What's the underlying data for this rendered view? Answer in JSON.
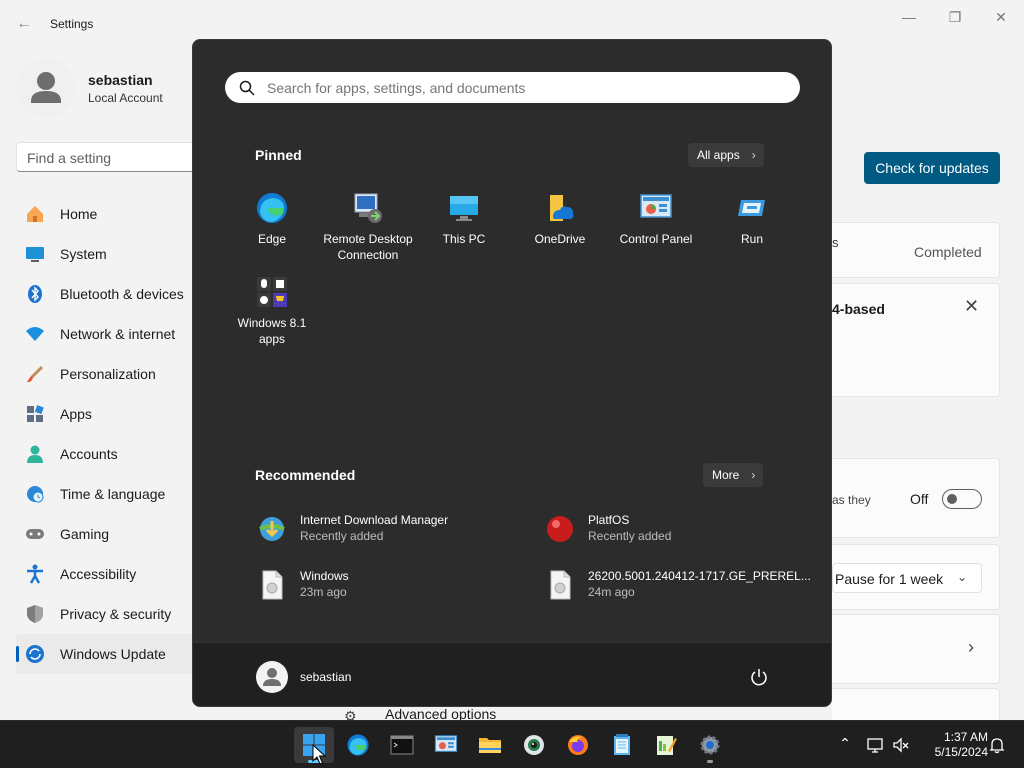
{
  "settings": {
    "app_title": "Settings",
    "user": {
      "name": "sebastian",
      "account_type": "Local Account"
    },
    "search_placeholder": "Find a setting",
    "nav": [
      {
        "label": "Home",
        "icon": "home-icon"
      },
      {
        "label": "System",
        "icon": "monitor-icon"
      },
      {
        "label": "Bluetooth & devices",
        "icon": "bluetooth-icon"
      },
      {
        "label": "Network & internet",
        "icon": "wifi-icon"
      },
      {
        "label": "Personalization",
        "icon": "brush-icon"
      },
      {
        "label": "Apps",
        "icon": "apps-icon"
      },
      {
        "label": "Accounts",
        "icon": "person-icon"
      },
      {
        "label": "Time & language",
        "icon": "clock-globe-icon"
      },
      {
        "label": "Gaming",
        "icon": "gamepad-icon"
      },
      {
        "label": "Accessibility",
        "icon": "accessibility-icon"
      },
      {
        "label": "Privacy & security",
        "icon": "shield-icon"
      },
      {
        "label": "Windows Update",
        "icon": "update-icon",
        "active": true
      }
    ],
    "check_updates_label": "Check for updates",
    "card_fragment_s": "s",
    "status_completed": "Completed",
    "card_fragment_based": "4-based",
    "card_fragment_asthey": "as they",
    "toggle_label": "Off",
    "pause_label": "Pause for 1 week",
    "advanced_options": "Advanced options"
  },
  "start_menu": {
    "search_placeholder": "Search for apps, settings, and documents",
    "pinned_title": "Pinned",
    "all_apps_label": "All apps",
    "pinned": [
      {
        "label": "Edge",
        "icon": "edge-icon"
      },
      {
        "label": "Remote Desktop Connection",
        "icon": "remote-desktop-icon"
      },
      {
        "label": "This PC",
        "icon": "this-pc-icon"
      },
      {
        "label": "OneDrive",
        "icon": "onedrive-icon"
      },
      {
        "label": "Control Panel",
        "icon": "control-panel-icon"
      },
      {
        "label": "Run",
        "icon": "run-icon"
      },
      {
        "label": "Windows 8.1 apps",
        "icon": "windows81-apps-icon"
      }
    ],
    "recommended_title": "Recommended",
    "more_label": "More",
    "recommended": [
      {
        "title": "Internet Download Manager",
        "subtitle": "Recently added",
        "icon": "idm-icon"
      },
      {
        "title": "PlatfOS",
        "subtitle": "Recently added",
        "icon": "red-ball-icon"
      },
      {
        "title": "Windows",
        "subtitle": "23m ago",
        "icon": "file-icon"
      },
      {
        "title": "26200.5001.240412-1717.GE_PREREL...",
        "subtitle": "24m ago",
        "icon": "file-icon"
      }
    ],
    "user_name": "sebastian"
  },
  "taskbar": {
    "apps": [
      {
        "name": "start-button",
        "icon": "windows-logo-icon",
        "active": true
      },
      {
        "name": "edge-taskbar",
        "icon": "edge-icon"
      },
      {
        "name": "terminal-taskbar",
        "icon": "terminal-icon"
      },
      {
        "name": "control-panel-taskbar",
        "icon": "control-panel-icon"
      },
      {
        "name": "file-explorer-taskbar",
        "icon": "folder-icon"
      },
      {
        "name": "browser-taskbar",
        "icon": "globe-icon"
      },
      {
        "name": "firefox-taskbar",
        "icon": "firefox-icon"
      },
      {
        "name": "notepad-taskbar",
        "icon": "notepad-icon"
      },
      {
        "name": "editor-taskbar",
        "icon": "editor-icon"
      },
      {
        "name": "settings-taskbar",
        "icon": "gear-icon"
      }
    ],
    "time": "1:37 AM",
    "date": "5/15/2024"
  }
}
